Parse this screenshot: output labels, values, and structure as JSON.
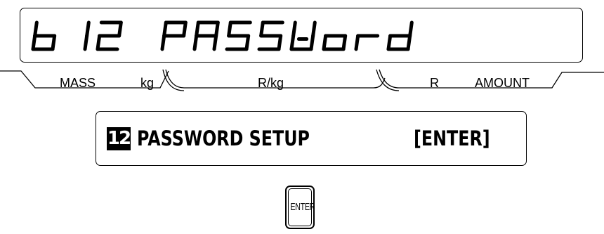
{
  "lcd": {
    "display_text": "b12 PASSWord",
    "glyphs": [
      "b",
      "1",
      "2",
      "",
      "P",
      "A",
      "S",
      "S",
      "W",
      "o",
      "r",
      "d"
    ]
  },
  "units": {
    "mass": "MASS",
    "kg": "kg",
    "rate": "R/kg",
    "currency": "R",
    "amount": "AMOUNT"
  },
  "guide": {
    "step_number": "12",
    "title": "PASSWORD SETUP",
    "key_hint": "[ENTER]"
  },
  "keys": {
    "enter_label": "ENTER"
  }
}
